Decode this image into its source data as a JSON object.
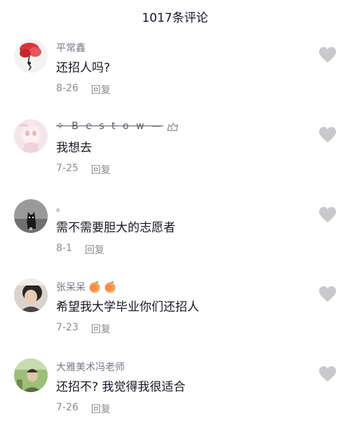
{
  "header": {
    "title": "1017条评论"
  },
  "comments": [
    {
      "username": "平常鑫",
      "text": "还招人吗?",
      "date": "8-26",
      "reply_label": "回复",
      "avatar_icon": "red-flower-avatar"
    },
    {
      "username": "✧ B e s t o w —",
      "text": "我想去",
      "date": "7-25",
      "reply_label": "回复",
      "avatar_icon": "pink-illustration-avatar",
      "name_suffix_icon": "pet-icon"
    },
    {
      "username": "。",
      "text": "需不需要胆大的志愿者",
      "date": "8-1",
      "reply_label": "回复",
      "avatar_icon": "dark-cat-avatar"
    },
    {
      "username": "张呆呆",
      "text": "希望我大学毕业你们还招人",
      "date": "7-23",
      "reply_label": "回复",
      "avatar_icon": "person-photo-avatar",
      "name_suffix_icons": [
        "peach-emoji",
        "peach-emoji"
      ]
    },
    {
      "username": "大雅美术冯老师",
      "text": "还招不? 我觉得我很适合",
      "date": "7-26",
      "reply_label": "回复",
      "avatar_icon": "outdoor-photo-avatar"
    }
  ],
  "colors": {
    "text_primary": "#161823",
    "text_secondary": "#757985",
    "meta": "#8a8b91",
    "like_icon": "#c9c9cc"
  }
}
